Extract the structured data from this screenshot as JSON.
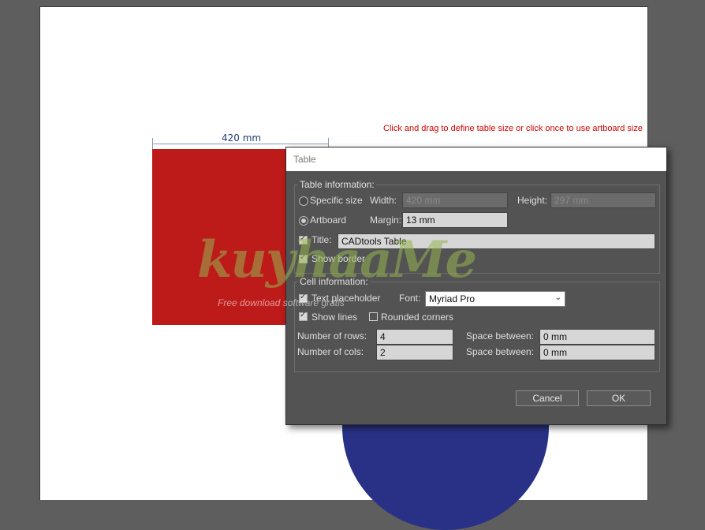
{
  "canvas": {
    "dimension_label": "420 mm",
    "hint_text": "Click and drag to define table size or click once to use artboard size",
    "colors": {
      "red_rect": "#bd1a1a",
      "blue_circle": "#283185",
      "hint": "#d00000"
    }
  },
  "dialog": {
    "title": "Table",
    "table_info": {
      "heading": "Table information:",
      "specific_size_label": "Specific size",
      "width_label": "Width:",
      "width_value": "420 mm",
      "height_label": "Height:",
      "height_value": "297 mm",
      "artboard_label": "Artboard",
      "margin_label": "Margin:",
      "margin_value": "13 mm",
      "title_label": "Title:",
      "title_value": "CADtools Table",
      "show_border_label": "Show border"
    },
    "cell_info": {
      "heading": "Cell information:",
      "text_placeholder_label": "Text placeholder",
      "font_label": "Font:",
      "font_value": "Myriad Pro",
      "show_lines_label": "Show lines",
      "rounded_corners_label": "Rounded corners",
      "rows_label": "Number of rows:",
      "rows_value": "4",
      "cols_label": "Number of cols:",
      "cols_value": "2",
      "space_between_label": "Space between:",
      "row_space_value": "0 mm",
      "col_space_value": "0 mm"
    },
    "buttons": {
      "cancel": "Cancel",
      "ok": "OK"
    }
  },
  "watermark": {
    "brand": "kuyhaaMe",
    "tagline": "Free download software gratis"
  }
}
